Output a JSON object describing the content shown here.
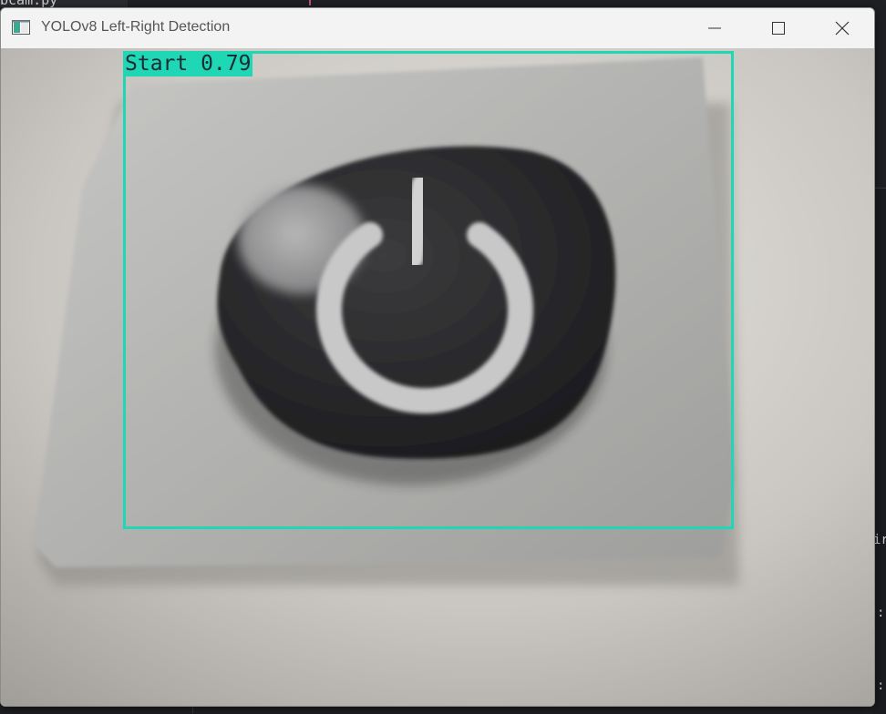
{
  "background": {
    "tab_text": "bcam.py",
    "right_text_1": "ir",
    "right_text_2": ":",
    "right_text_3": ":"
  },
  "window": {
    "title": "YOLOv8 Left-Right Detection",
    "icons": {
      "app": "app-window-icon",
      "minimize": "minimize-icon",
      "maximize": "maximize-icon",
      "close": "close-icon"
    }
  },
  "detection": {
    "label": "Start 0.79",
    "class": "Start",
    "confidence": 0.79,
    "box_color": "#1fd7b4"
  },
  "colors": {
    "box": "#1fd7b4",
    "titlebar": "#f3f3f3"
  }
}
